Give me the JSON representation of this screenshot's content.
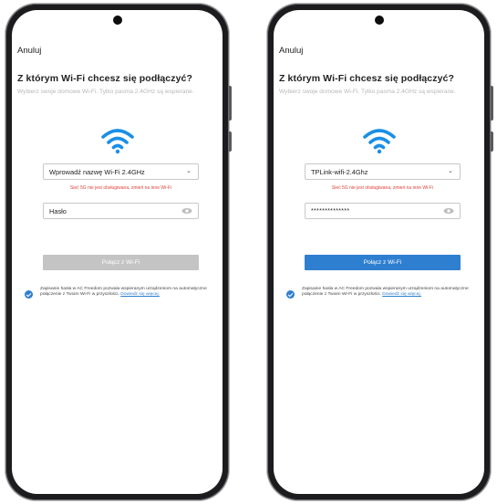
{
  "screens": [
    {
      "cancel_label": "Anuluj",
      "title": "Z którym Wi-Fi chcesz się podłączyć?",
      "subtitle": "Wybierz swoje domowe Wi-Fi. Tylko pasma 2.4GHz są wspierane.",
      "ssid_value": "Wprowadź nazwę Wi-Fi 2.4GHz",
      "warning": "Sieć 5G nie jest obsługiwana, zmień na inne Wi-Fi",
      "password_value": "Hasło",
      "connect_label": "Połącz z Wi-Fi",
      "connect_state": "disabled",
      "consent_text": "Zapisanie hasła w AC Freedom pozwala wspieranym urządzeniom na automatyczne połączenie z Twoim Wi-Fi w przyszłości.",
      "consent_link": "Dowiedz się więcej."
    },
    {
      "cancel_label": "Anuluj",
      "title": "Z którym Wi-Fi chcesz się podłączyć?",
      "subtitle": "Wybierz swoje domowe Wi-Fi. Tylko pasma 2.4GHz są wspierane.",
      "ssid_value": "TPLink-wifi-2.4Ghz",
      "warning": "Sieć 5G nie jest obsługiwana, zmień na inne Wi-Fi",
      "password_value": "**************",
      "connect_label": "Połącz z Wi-Fi",
      "connect_state": "enabled",
      "consent_text": "Zapisanie hasła w AC Freedom pozwala wspieranym urządzeniom na automatyczne połączenie z Twoim Wi-Fi w przyszłości.",
      "consent_link": "Dowiedz się więcej."
    }
  ],
  "colors": {
    "accent": "#2f7fd0",
    "wifi_icon": "#1a8fe6",
    "warning": "#e0433b",
    "disabled_button": "#c4c4c4"
  },
  "icons": {
    "wifi": "wifi-icon",
    "dropdown": "chevron-down-icon",
    "password_visibility": "eye-icon",
    "consent_check": "checkmark-circle-icon"
  }
}
